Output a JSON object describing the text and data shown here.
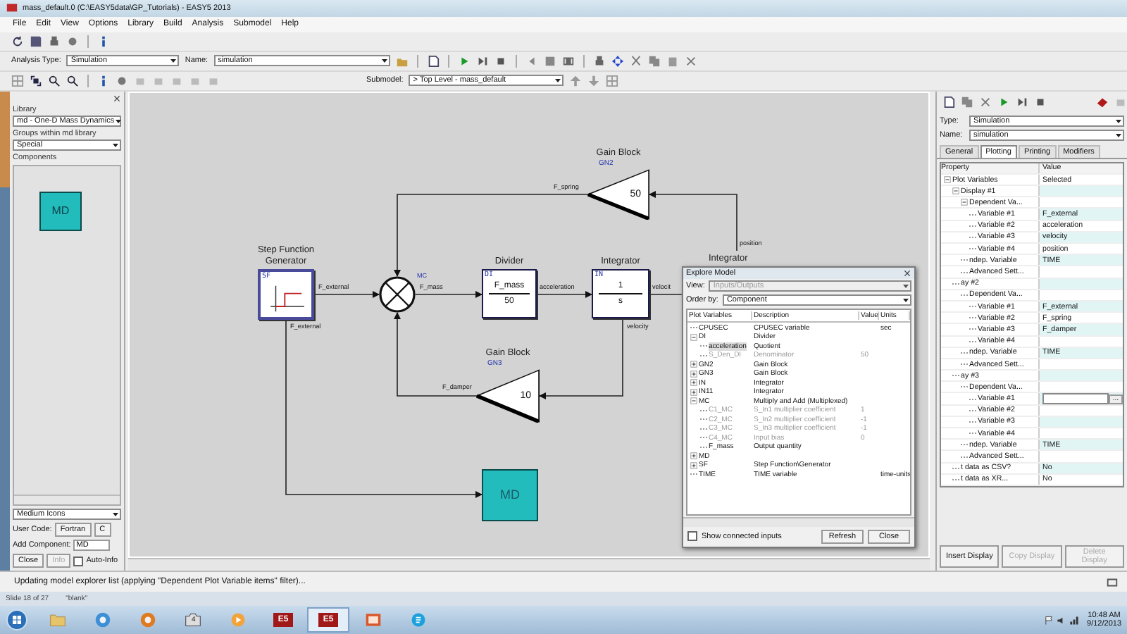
{
  "window": {
    "title": "mass_default.0 (C:\\EASY5data\\GP_Tutorials) - EASY5 2013"
  },
  "menu": [
    "File",
    "Edit",
    "View",
    "Options",
    "Library",
    "Build",
    "Analysis",
    "Submodel",
    "Help"
  ],
  "toolbar": {
    "analysis_type_label": "Analysis Type:",
    "analysis_type": "Simulation",
    "name_label": "Name:",
    "name": "simulation",
    "submodel_label": "Submodel:",
    "submodel": "> Top Level - mass_default"
  },
  "library_panel": {
    "library_label": "Library",
    "library": "md - One-D Mass Dynamics",
    "groups_label": "Groups within md library",
    "group": "Special",
    "components_label": "Components",
    "components": [
      {
        "label": "MD"
      }
    ],
    "icon_size": "Medium Icons",
    "user_code_label": "User Code:",
    "user_code_buttons": [
      "Fortran",
      "C"
    ],
    "add_label": "Add Component:",
    "add_value": "MD",
    "buttons": [
      {
        "label": "Close",
        "disabled": false
      },
      {
        "label": "Info",
        "disabled": true
      }
    ],
    "auto_info": {
      "label": "Auto-Info",
      "checked": false
    }
  },
  "diagram": {
    "blocks": [
      {
        "kind": "gain",
        "title": "Gain Block",
        "tag": "GN2",
        "gain": "50"
      },
      {
        "kind": "step",
        "title": "Step Function Generator",
        "tag": "SF"
      },
      {
        "kind": "sum",
        "tag": "MC"
      },
      {
        "kind": "fraction",
        "title": "Divider",
        "tag": "DI",
        "numerator": "F_mass",
        "denominator": "50"
      },
      {
        "kind": "fraction",
        "title": "Integrator",
        "tag": "IN",
        "numerator": "1",
        "denominator": "s"
      },
      {
        "kind": "gain",
        "title": "Gain Block",
        "tag": "GN3",
        "gain": "10"
      },
      {
        "kind": "mass",
        "label": "MD"
      }
    ],
    "labels": [
      {
        "kind": "signal",
        "text": "F_external"
      },
      {
        "kind": "signal",
        "text": "F_external"
      },
      {
        "kind": "signal",
        "text": "F_mass"
      },
      {
        "kind": "signal",
        "text": "acceleration"
      },
      {
        "kind": "signal",
        "text": "velocit"
      },
      {
        "kind": "signal",
        "text": "velocity"
      },
      {
        "kind": "signal",
        "text": "F_spring"
      },
      {
        "kind": "signal",
        "text": "F_damper"
      },
      {
        "kind": "signal",
        "text": "position"
      },
      {
        "kind": "title",
        "text": "Integrator"
      }
    ]
  },
  "explorer": {
    "title": "Explore Model",
    "view_label": "View:",
    "view": "Inputs/Outputs",
    "view_disabled": true,
    "order_label": "Order by:",
    "order": "Component",
    "columns": [
      "Plot Variables",
      "Description",
      "Value",
      "Units"
    ],
    "rows": [
      {
        "name": "CPUSEC",
        "description": "CPUSEC variable",
        "units": "sec",
        "dimmed": false,
        "selected": false
      },
      {
        "name": "DI",
        "description": "Divider",
        "expanded": true,
        "dimmed": false,
        "selected": false,
        "children": [
          {
            "name": "acceleration",
            "description": "Quotient",
            "dimmed": false,
            "selected": true
          },
          {
            "name": "S_Den_DI",
            "description": "Denominator",
            "value": "50",
            "dimmed": true,
            "selected": false
          }
        ]
      },
      {
        "name": "GN2",
        "description": "Gain Block",
        "expanded": false,
        "dimmed": false,
        "selected": false
      },
      {
        "name": "GN3",
        "description": "Gain Block",
        "expanded": false,
        "dimmed": false,
        "selected": false
      },
      {
        "name": "IN",
        "description": "Integrator",
        "expanded": false,
        "dimmed": false,
        "selected": false
      },
      {
        "name": "IN11",
        "description": "Integrator",
        "expanded": false,
        "dimmed": false,
        "selected": false
      },
      {
        "name": "MC",
        "description": "Multiply and Add (Multiplexed)",
        "expanded": true,
        "dimmed": false,
        "selected": false,
        "children": [
          {
            "name": "C1_MC",
            "description": "S_In1 multiplier coefficient",
            "value": "1",
            "dimmed": true,
            "selected": false
          },
          {
            "name": "C2_MC",
            "description": "S_In2 multiplier coefficient",
            "value": "-1",
            "dimmed": true,
            "selected": false
          },
          {
            "name": "C3_MC",
            "description": "S_In3 multiplier coefficient",
            "value": "-1",
            "dimmed": true,
            "selected": false
          },
          {
            "name": "C4_MC",
            "description": "Input bias",
            "value": "0",
            "dimmed": true,
            "selected": false
          },
          {
            "name": "F_mass",
            "description": "Output quantity",
            "dimmed": false,
            "selected": false
          }
        ]
      },
      {
        "name": "MD",
        "expanded": false,
        "dimmed": false,
        "selected": false
      },
      {
        "name": "SF",
        "description": "Step Function\\Generator",
        "expanded": false,
        "dimmed": false,
        "selected": false
      },
      {
        "name": "TIME",
        "description": "TIME variable",
        "units": "time-units",
        "dimmed": false,
        "selected": false
      }
    ],
    "show_connected": {
      "label": "Show connected inputs",
      "checked": false
    },
    "buttons": [
      "Refresh",
      "Close"
    ]
  },
  "properties": {
    "type_label": "Type:",
    "type": "Simulation",
    "name_label": "Name:",
    "name": "simulation",
    "tabs": [
      {
        "label": "General",
        "selected": false
      },
      {
        "label": "Plotting",
        "selected": true
      },
      {
        "label": "Printing",
        "selected": false
      },
      {
        "label": "Modifiers",
        "selected": false
      }
    ],
    "columns": [
      "Property",
      "Value"
    ],
    "rows": [
      {
        "label": "Plot Variables",
        "value": "Selected",
        "expanded": true,
        "children": [
          {
            "label": "Display #1",
            "expanded": true,
            "children": [
              {
                "label": "Dependent Va...",
                "expanded": true,
                "children": [
                  {
                    "label": "Variable #1",
                    "value": "F_external",
                    "editing": false
                  },
                  {
                    "label": "Variable #2",
                    "value": "acceleration",
                    "editing": false
                  },
                  {
                    "label": "Variable #3",
                    "value": "velocity",
                    "editing": false
                  },
                  {
                    "label": "Variable #4",
                    "value": "position",
                    "editing": false
                  }
                ]
              },
              {
                "label": "ndep. Variable",
                "value": "TIME"
              },
              {
                "label": "Advanced Sett..."
              }
            ]
          },
          {
            "label": "ay #2",
            "children": [
              {
                "label": "Dependent Va...",
                "children": [
                  {
                    "label": "Variable #1",
                    "value": "F_external",
                    "editing": false
                  },
                  {
                    "label": "Variable #2",
                    "value": "F_spring",
                    "editing": false
                  },
                  {
                    "label": "Variable #3",
                    "value": "F_damper",
                    "editing": false
                  },
                  {
                    "label": "Variable #4",
                    "editing": false
                  }
                ]
              },
              {
                "label": "ndep. Variable",
                "value": "TIME"
              },
              {
                "label": "Advanced Sett..."
              }
            ]
          },
          {
            "label": "ay #3",
            "children": [
              {
                "label": "Dependent Va...",
                "children": [
                  {
                    "label": "Variable #1",
                    "editing": true,
                    "button": "..."
                  },
                  {
                    "label": "Variable #2",
                    "editing": false
                  },
                  {
                    "label": "Variable #3",
                    "editing": false
                  },
                  {
                    "label": "Variable #4",
                    "editing": false
                  }
                ]
              },
              {
                "label": "ndep. Variable",
                "value": "TIME"
              },
              {
                "label": "Advanced Sett..."
              }
            ]
          },
          {
            "label": "t data as CSV?",
            "value": "No"
          },
          {
            "label": "t data as XR...",
            "value": "No"
          }
        ]
      }
    ],
    "buttons": [
      {
        "label": "Insert Display",
        "disabled": false
      },
      {
        "label": "Copy Display",
        "disabled": true
      },
      {
        "label": "Delete Display",
        "disabled": true
      }
    ]
  },
  "status_bar": "Updating model explorer list (applying \"Dependent Plot Variable items\" filter)...",
  "slide_bar": {
    "slide": "Slide 18 of 27",
    "theme": "\"blank\""
  },
  "taskbar": {
    "apps": [
      {
        "kind": "folder",
        "selected": false
      },
      {
        "kind": "globe",
        "selected": false
      },
      {
        "kind": "globe",
        "selected": false
      },
      {
        "kind": "camera",
        "badge": "4",
        "selected": false
      },
      {
        "kind": "media",
        "selected": false
      },
      {
        "kind": "e5",
        "label": "E5",
        "selected": false
      },
      {
        "kind": "e5",
        "label": "E5",
        "selected": true
      },
      {
        "kind": "slides",
        "selected": false
      },
      {
        "kind": "chat",
        "selected": false
      }
    ],
    "time": "10:48 AM",
    "date": "9/12/2013"
  }
}
